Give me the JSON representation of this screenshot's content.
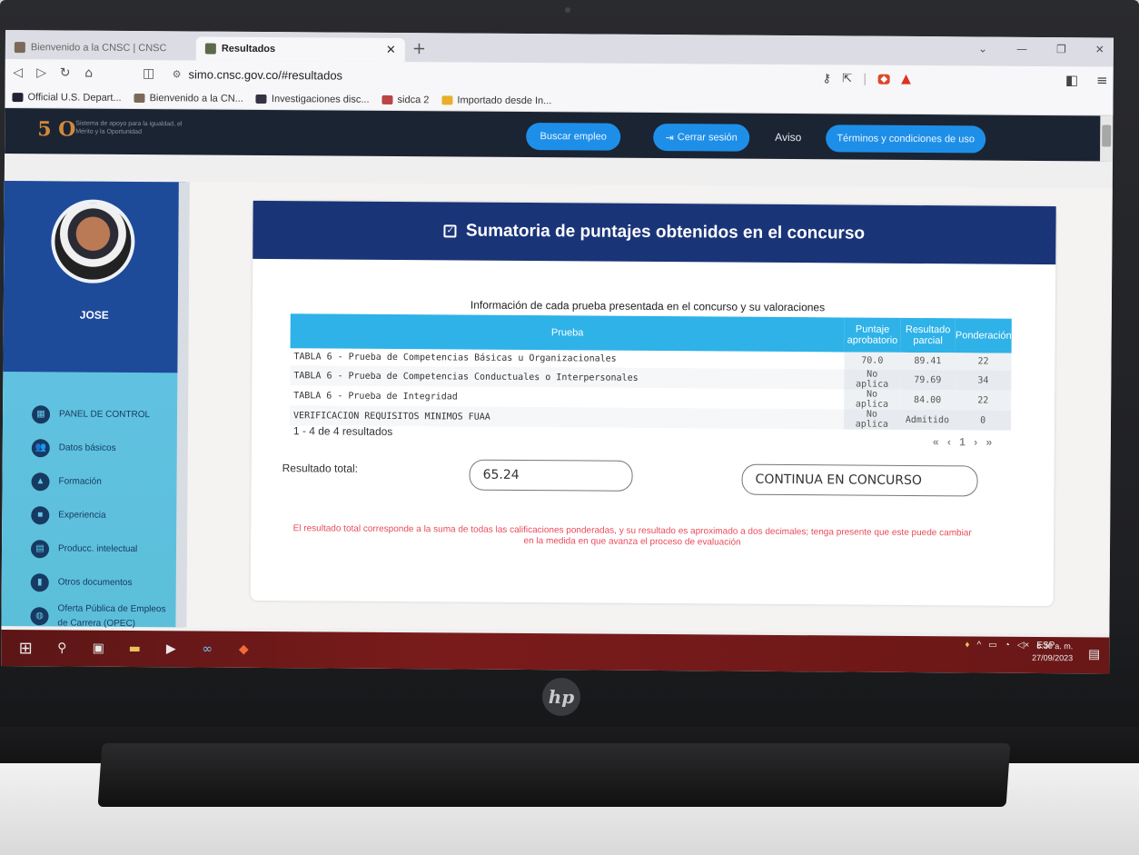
{
  "browser": {
    "tabs": [
      {
        "label": "Bienvenido a la CNSC | CNSC",
        "active": false
      },
      {
        "label": "Resultados",
        "active": true
      }
    ],
    "url": "simo.cnsc.gov.co/#resultados",
    "bookmarks": [
      "Official U.S. Depart...",
      "Bienvenido a la CN...",
      "Investigaciones disc...",
      "sidca 2",
      "Importado desde In..."
    ]
  },
  "header": {
    "logo_text": "Sistema de apoyo para la igualdad, el Mérito y la Oportunidad",
    "buttons": [
      "Buscar empleo",
      "Cerrar sesión",
      "Aviso",
      "Términos y condiciones de uso"
    ]
  },
  "sidebar": {
    "user_name": "JOSE",
    "items": [
      {
        "label": "PANEL DE CONTROL",
        "icon": "dashboard-icon"
      },
      {
        "label": "Datos básicos",
        "icon": "users-icon"
      },
      {
        "label": "Formación",
        "icon": "graduation-icon"
      },
      {
        "label": "Experiencia",
        "icon": "briefcase-icon"
      },
      {
        "label": "Producc. intelectual",
        "icon": "book-icon"
      },
      {
        "label": "Otros documentos",
        "icon": "document-icon"
      },
      {
        "label": "Oferta Pública de Empleos de Carrera (OPEC)",
        "icon": "globe-icon"
      }
    ]
  },
  "card": {
    "title": "Sumatoria de puntajes obtenidos en el concurso",
    "caption": "Información de cada prueba presentada en el concurso y su valoraciones",
    "columns": [
      "Prueba",
      "Puntaje aprobatorio",
      "Resultado parcial",
      "Ponderación"
    ],
    "rows": [
      [
        "TABLA 6 - Prueba de Competencias Básicas u Organizacionales",
        "70.0",
        "89.41",
        "22"
      ],
      [
        "TABLA 6 - Prueba de Competencias Conductuales o Interpersonales",
        "No aplica",
        "79.69",
        "34"
      ],
      [
        "TABLA 6 - Prueba de Integridad",
        "No aplica",
        "84.00",
        "22"
      ],
      [
        "VERIFICACION REQUISITOS MINIMOS FUAA",
        "No aplica",
        "Admitido",
        "0"
      ]
    ],
    "count_text": "1 - 4 de 4 resultados",
    "pager": "« ‹ 1 › »",
    "total_label": "Resultado total:",
    "total_value": "65.24",
    "status_value": "CONTINUA EN CONCURSO",
    "note": "El resultado total corresponde a la suma de todas las calificaciones ponderadas, y su resultado es aproximado a dos decimales; tenga presente que este puede cambiar en la medida en que avanza el proceso de evaluación"
  },
  "taskbar": {
    "lang": "ESP",
    "time": "6:30 a. m.",
    "date": "27/09/2023"
  }
}
